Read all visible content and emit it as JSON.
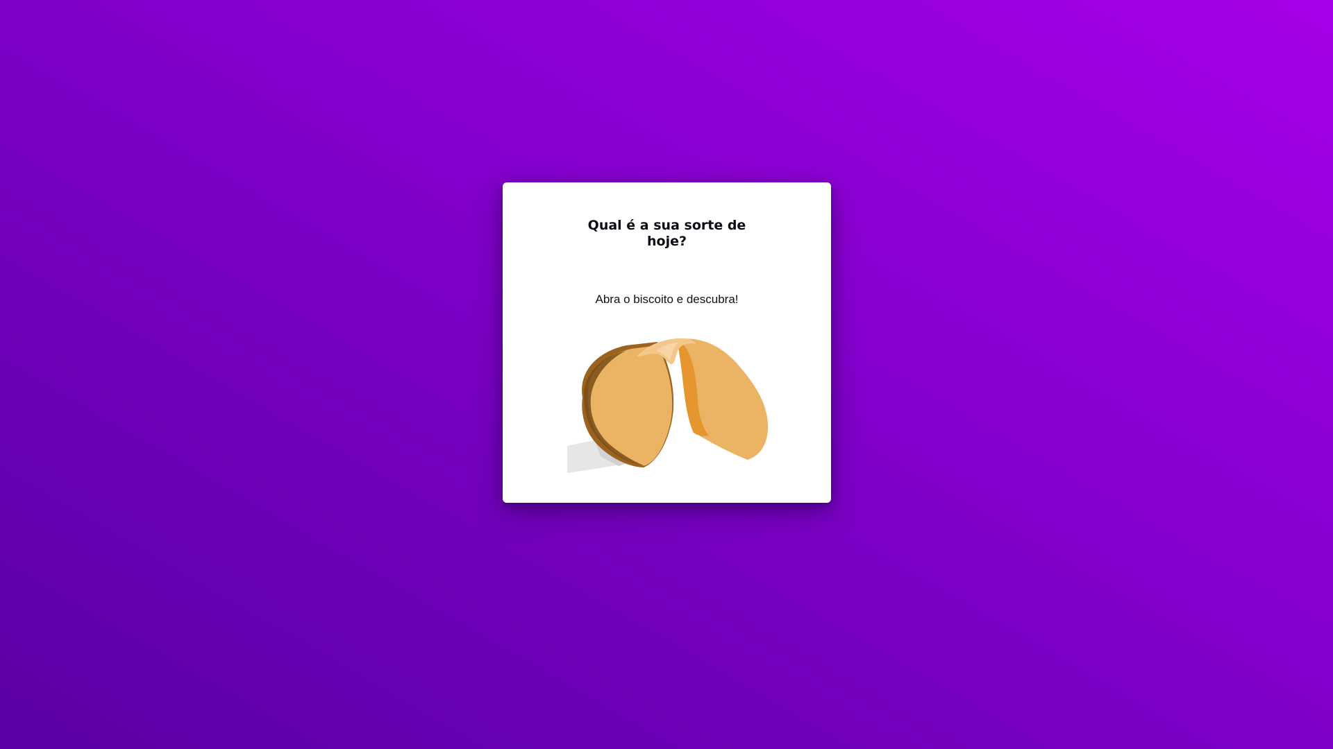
{
  "card": {
    "title": "Qual é a sua sorte de hoje?",
    "subtitle": "Abra o biscoito e descubra!",
    "cookie_icon": "fortune-cookie-icon"
  },
  "colors": {
    "background_start": "#5a00a6",
    "background_end": "#a600ea",
    "card": "#ffffff",
    "cookie_body": "#ebb464",
    "cookie_inner": "#e5962e",
    "cookie_edge": "#8a5a1c",
    "paper": "#e6e6e6"
  }
}
